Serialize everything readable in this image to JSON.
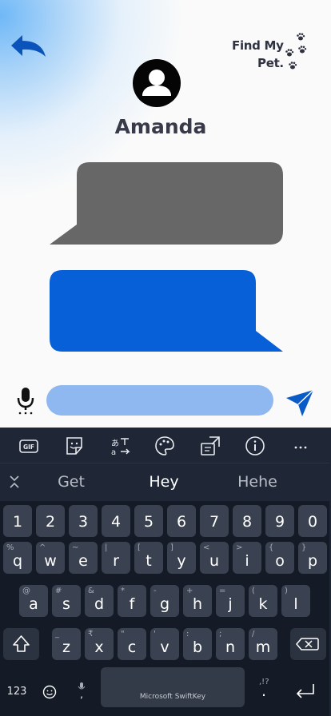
{
  "contact": {
    "name": "Amanda"
  },
  "logo": {
    "line1": "Find My",
    "line2": "Pet."
  },
  "composer": {
    "value": "",
    "placeholder": ""
  },
  "colors": {
    "incoming_bubble": "#676767",
    "outgoing_bubble": "#0760d8",
    "input_bg": "#8eb8ef",
    "send": "#0b5bc7",
    "back": "#0a53bb"
  },
  "keyboard": {
    "toolbar_icons": [
      "gif-icon",
      "sticker-icon",
      "translate-icon",
      "palette-icon",
      "resize-icon",
      "info-icon",
      "more-icon"
    ],
    "suggestions": [
      "Get",
      "Hey",
      "Hehe"
    ],
    "number_row": [
      "1",
      "2",
      "3",
      "4",
      "5",
      "6",
      "7",
      "8",
      "9",
      "0"
    ],
    "row1": {
      "keys": [
        "q",
        "w",
        "e",
        "r",
        "t",
        "y",
        "u",
        "i",
        "o",
        "p"
      ],
      "hints": [
        "%",
        "^",
        "~",
        "|",
        "[",
        "]",
        "<",
        ">",
        "{",
        "}"
      ]
    },
    "row2": {
      "keys": [
        "a",
        "s",
        "d",
        "f",
        "g",
        "h",
        "j",
        "k",
        "l"
      ],
      "hints": [
        "@",
        "#",
        "&",
        "*",
        "-",
        "+",
        "=",
        "(",
        ")"
      ]
    },
    "row3": {
      "keys": [
        "z",
        "x",
        "c",
        "v",
        "b",
        "n",
        "m"
      ],
      "hints": [
        "_",
        "₹",
        "\"",
        "'",
        ":",
        ";",
        "/"
      ]
    },
    "bottom": {
      "numbers_label": "123",
      "space_label": "Microsoft SwiftKey",
      "period_hint": ",!?",
      "period": "."
    }
  }
}
